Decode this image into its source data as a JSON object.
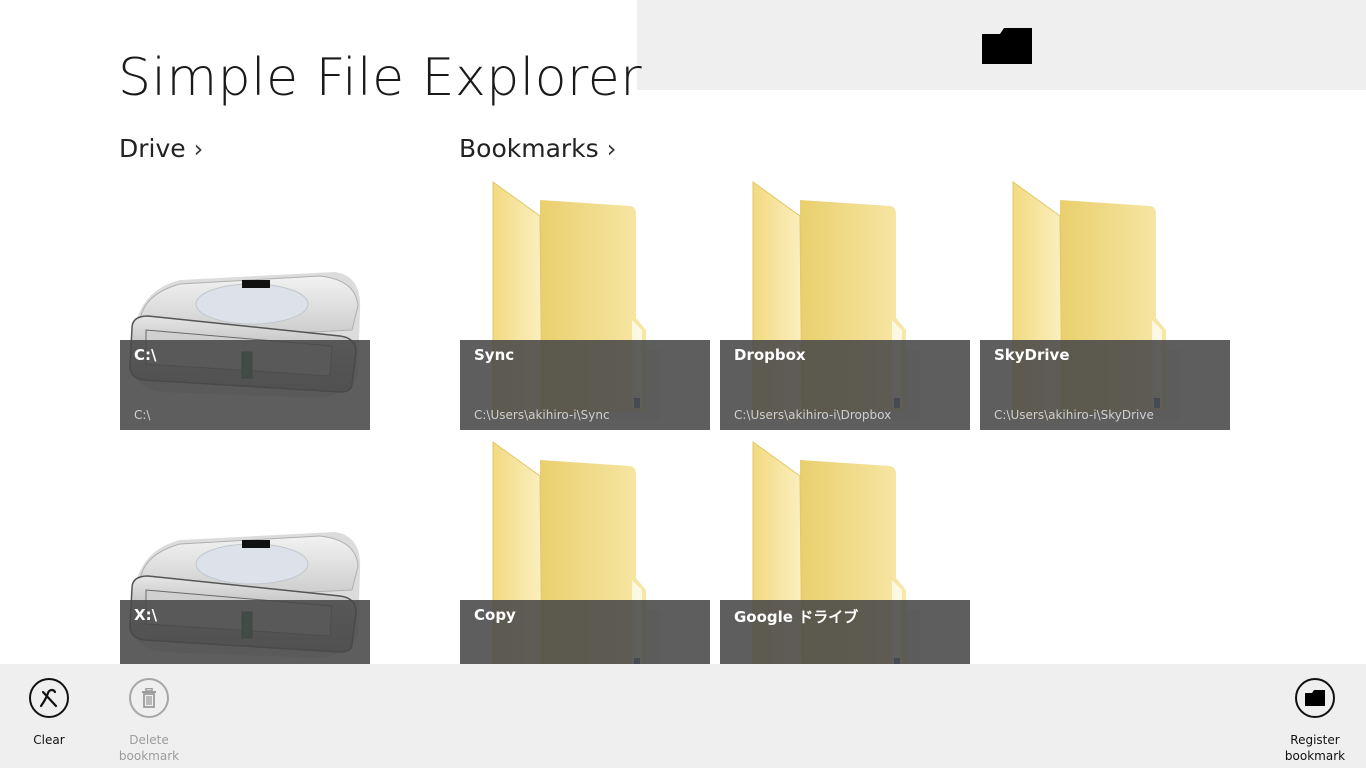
{
  "app": {
    "title": "Simple File Explorer"
  },
  "sections": {
    "drive": "Drive",
    "bookmarks": "Bookmarks",
    "chevron": "›"
  },
  "drives": [
    {
      "name": "C:\\",
      "path": "C:\\"
    },
    {
      "name": "X:\\",
      "path": ""
    }
  ],
  "bookmarks": [
    {
      "name": "Sync",
      "path": "C:\\Users\\akihiro-i\\Sync"
    },
    {
      "name": "Dropbox",
      "path": "C:\\Users\\akihiro-i\\Dropbox"
    },
    {
      "name": "SkyDrive",
      "path": "C:\\Users\\akihiro-i\\SkyDrive"
    },
    {
      "name": "Copy",
      "path": ""
    },
    {
      "name": "Google ドライブ",
      "path": ""
    }
  ],
  "appbar": {
    "clear": "Clear",
    "delete_line1": "Delete",
    "delete_line2": "bookmark",
    "register_line1": "Register",
    "register_line2": "bookmark"
  },
  "icons": {
    "top": "folder-icon",
    "drive": "hard-drive-icon",
    "bookmark": "folder-icon",
    "clear": "clear-x-icon",
    "delete": "trash-icon",
    "register": "folder-icon"
  },
  "colors": {
    "top_panel": "#efefef",
    "tile_overlay": "#484848",
    "folder": "#f4de8a",
    "appbar": "#efefef"
  }
}
